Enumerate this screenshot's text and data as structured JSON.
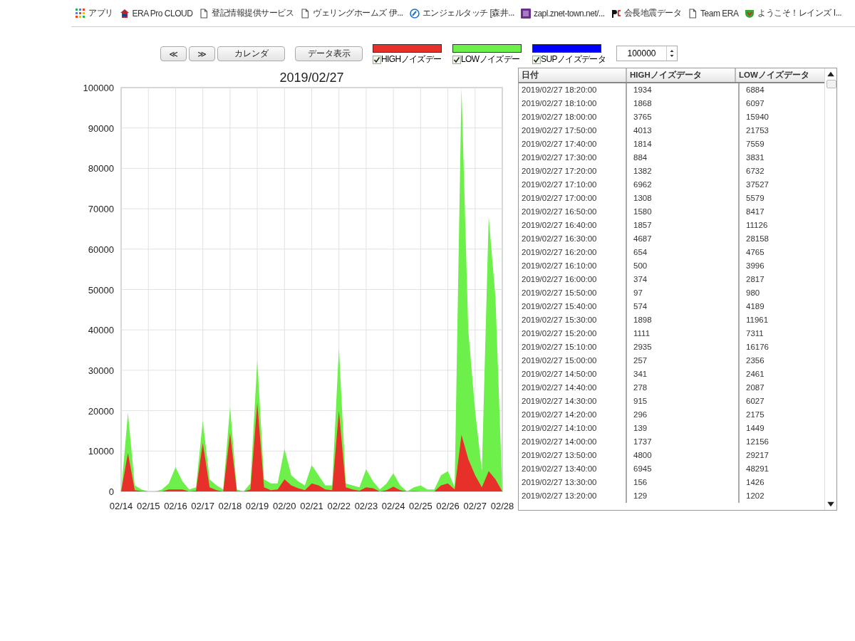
{
  "bookmarks": [
    {
      "kind": "apps",
      "label": "アプリ"
    },
    {
      "kind": "house",
      "label": "ERA Pro CLOUD"
    },
    {
      "kind": "page",
      "label": "登記情報提供サービス"
    },
    {
      "kind": "page",
      "label": "ヴェリングホームズ 伊..."
    },
    {
      "kind": "swirl",
      "label": "エンジェルタッチ [森井..."
    },
    {
      "kind": "square",
      "label": "zapl.znet-town.net/..."
    },
    {
      "kind": "logo",
      "label": "会長地震データ"
    },
    {
      "kind": "page",
      "label": "Team ERA"
    },
    {
      "kind": "shield",
      "label": "ようこそ！レインズ I..."
    }
  ],
  "toolbar": {
    "prev": "≪",
    "next": "≫",
    "calendar": "カレンダ",
    "show_data": "データ表示",
    "limit": "100000"
  },
  "legend": [
    {
      "label": "HIGHノイズデー",
      "color": "#e8302a",
      "checked": true
    },
    {
      "label": "LOWノイズデー",
      "color": "#6ef04a",
      "checked": true
    },
    {
      "label": "SUPノイズデータ",
      "color": "#0000ff",
      "checked": true
    }
  ],
  "chart": {
    "chart_data": {
      "type": "area",
      "title": "2019/02/27",
      "stacked": false,
      "grid": true,
      "ylim": [
        0,
        100000
      ],
      "yticks": [
        0,
        10000,
        20000,
        30000,
        40000,
        50000,
        60000,
        70000,
        80000,
        90000,
        100000
      ],
      "categories": [
        "02/14",
        null,
        null,
        null,
        "02/15",
        null,
        null,
        null,
        "02/16",
        null,
        null,
        null,
        "02/17",
        null,
        null,
        null,
        "02/18",
        null,
        null,
        null,
        "02/19",
        null,
        null,
        null,
        "02/20",
        null,
        null,
        null,
        "02/21",
        null,
        null,
        null,
        "02/22",
        null,
        null,
        null,
        "02/23",
        null,
        null,
        null,
        "02/24",
        null,
        null,
        null,
        "02/25",
        null,
        null,
        null,
        "02/26",
        null,
        null,
        null,
        "02/27",
        null,
        null,
        null,
        "02/28"
      ],
      "series": [
        {
          "color": "#6ef04a",
          "values": [
            0,
            19500,
            1500,
            500,
            0,
            0,
            500,
            2000,
            6000,
            2500,
            500,
            1000,
            17500,
            3000,
            1500,
            500,
            21000,
            500,
            0,
            2000,
            32500,
            3000,
            2000,
            2000,
            10500,
            4000,
            2500,
            1500,
            6500,
            4000,
            1500,
            1500,
            35500,
            2000,
            1500,
            1000,
            5500,
            2500,
            500,
            2000,
            4500,
            1500,
            0,
            1000,
            1500,
            500,
            500,
            4000,
            5000,
            1000,
            100000,
            40000,
            20000,
            5000,
            68000,
            48000,
            0
          ]
        },
        {
          "color": "#e8302a",
          "values": [
            0,
            9500,
            300,
            100,
            0,
            0,
            0,
            500,
            500,
            500,
            0,
            200,
            12000,
            1000,
            300,
            0,
            14500,
            100,
            0,
            500,
            22000,
            1000,
            300,
            500,
            3000,
            1500,
            800,
            300,
            2000,
            1500,
            500,
            300,
            20000,
            1000,
            500,
            200,
            1000,
            800,
            0,
            300,
            1200,
            300,
            0,
            100,
            0,
            0,
            0,
            1500,
            2000,
            500,
            14000,
            8000,
            4000,
            1000,
            5000,
            3000,
            0
          ]
        }
      ]
    }
  },
  "table": {
    "columns": [
      "日付",
      "HIGHノイズデータ",
      "LOWノイズデータ"
    ],
    "rows": [
      [
        "2019/02/27 18:20:00",
        "1934",
        "6884"
      ],
      [
        "2019/02/27 18:10:00",
        "1868",
        "6097"
      ],
      [
        "2019/02/27 18:00:00",
        "3765",
        "15940"
      ],
      [
        "2019/02/27 17:50:00",
        "4013",
        "21753"
      ],
      [
        "2019/02/27 17:40:00",
        "1814",
        "7559"
      ],
      [
        "2019/02/27 17:30:00",
        "884",
        "3831"
      ],
      [
        "2019/02/27 17:20:00",
        "1382",
        "6732"
      ],
      [
        "2019/02/27 17:10:00",
        "6962",
        "37527"
      ],
      [
        "2019/02/27 17:00:00",
        "1308",
        "5579"
      ],
      [
        "2019/02/27 16:50:00",
        "1580",
        "8417"
      ],
      [
        "2019/02/27 16:40:00",
        "1857",
        "11126"
      ],
      [
        "2019/02/27 16:30:00",
        "4687",
        "28158"
      ],
      [
        "2019/02/27 16:20:00",
        "654",
        "4765"
      ],
      [
        "2019/02/27 16:10:00",
        "500",
        "3996"
      ],
      [
        "2019/02/27 16:00:00",
        "374",
        "2817"
      ],
      [
        "2019/02/27 15:50:00",
        "97",
        "980"
      ],
      [
        "2019/02/27 15:40:00",
        "574",
        "4189"
      ],
      [
        "2019/02/27 15:30:00",
        "1898",
        "11961"
      ],
      [
        "2019/02/27 15:20:00",
        "1111",
        "7311"
      ],
      [
        "2019/02/27 15:10:00",
        "2935",
        "16176"
      ],
      [
        "2019/02/27 15:00:00",
        "257",
        "2356"
      ],
      [
        "2019/02/27 14:50:00",
        "341",
        "2461"
      ],
      [
        "2019/02/27 14:40:00",
        "278",
        "2087"
      ],
      [
        "2019/02/27 14:30:00",
        "915",
        "6027"
      ],
      [
        "2019/02/27 14:20:00",
        "296",
        "2175"
      ],
      [
        "2019/02/27 14:10:00",
        "139",
        "1449"
      ],
      [
        "2019/02/27 14:00:00",
        "1737",
        "12156"
      ],
      [
        "2019/02/27 13:50:00",
        "4800",
        "29217"
      ],
      [
        "2019/02/27 13:40:00",
        "6945",
        "48291"
      ],
      [
        "2019/02/27 13:30:00",
        "156",
        "1426"
      ],
      [
        "2019/02/27 13:20:00",
        "129",
        "1202"
      ]
    ]
  }
}
